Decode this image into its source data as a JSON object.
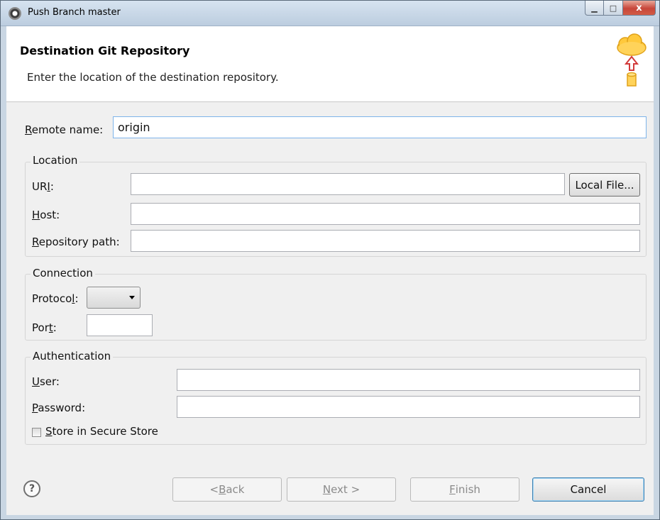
{
  "window": {
    "title": "Push Branch master",
    "minimize_glyph": "▁",
    "maximize_glyph": "□",
    "close_glyph": "x"
  },
  "header": {
    "title": "Destination Git Repository",
    "description": "Enter the location of the destination repository.",
    "icon": "cloud-upload-database-icon"
  },
  "remote": {
    "label_mnemonic": "R",
    "label_rest": "emote name:",
    "value": "origin"
  },
  "location": {
    "title": "Location",
    "uri_label_pre": "UR",
    "uri_label_mnemonic": "I",
    "uri_label_post": ":",
    "uri_value": "",
    "local_file_button": "Local File...",
    "host_label_mnemonic": "H",
    "host_label_rest": "ost:",
    "host_value": "",
    "repo_label_mnemonic": "R",
    "repo_label_rest": "epository path:",
    "repo_value": ""
  },
  "connection": {
    "title": "Connection",
    "protocol_label_pre": "Protoco",
    "protocol_label_mnemonic": "l",
    "protocol_label_post": ":",
    "protocol_value": "",
    "port_label_pre": "Por",
    "port_label_mnemonic": "t",
    "port_label_post": ":",
    "port_value": ""
  },
  "authentication": {
    "title": "Authentication",
    "user_label_mnemonic": "U",
    "user_label_rest": "ser:",
    "user_value": "",
    "password_label_mnemonic": "P",
    "password_label_rest": "assword:",
    "password_value": "",
    "store_label_mnemonic": "S",
    "store_label_rest": "tore in Secure Store",
    "store_checked": false
  },
  "footer": {
    "help_glyph": "?",
    "back_pre": "< ",
    "back_mnemonic": "B",
    "back_rest": "ack",
    "next_mnemonic": "N",
    "next_rest": "ext >",
    "finish_mnemonic": "F",
    "finish_rest": "inish",
    "cancel": "Cancel"
  }
}
